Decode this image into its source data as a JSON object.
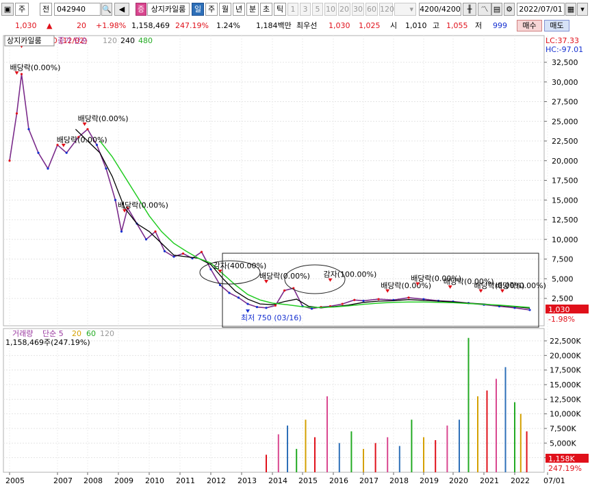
{
  "toolbar": {
    "period_type": "주",
    "prev_label": "전",
    "stock_code": "042940",
    "stock_badge": "증",
    "stock_name": "상지카일룸",
    "periods": [
      "일",
      "주",
      "월",
      "년",
      "분",
      "초",
      "틱"
    ],
    "selected_period": "일",
    "minute_options": [
      "1",
      "3",
      "5",
      "10",
      "20",
      "30",
      "60",
      "120"
    ],
    "count": "4200/4200",
    "date": "2022/07/01"
  },
  "info": {
    "price": "1,030",
    "change": "20",
    "change_pct": "+1.98%",
    "volume": "1,158,469",
    "volume_ratio": "247.19%",
    "turnover": "1.24%",
    "amount": "1,184백만",
    "best_label": "최우선",
    "best_ask": "1,030",
    "best_bid": "1,025",
    "open_label": "시",
    "open": "1,010",
    "high_label": "고",
    "high": "1,055",
    "low_label": "저",
    "low": "999",
    "buy_label": "매수",
    "sell_label": "매도"
  },
  "colors": {
    "up": "#e0101a",
    "down": "#1530d0",
    "ma120": "#000000",
    "ma240": "#22cc22",
    "price_line": "#7a2a8a"
  },
  "chart_data": [
    {
      "type": "line",
      "title": "상지카일룸",
      "legend": [
        "종가 단순",
        "120",
        "240",
        "480"
      ],
      "top_right_labels": [
        "LC:37.33",
        "HC:-97.01"
      ],
      "x_ticks": [
        "2005",
        "2007",
        "2008",
        "2009",
        "2010",
        "2011",
        "2012",
        "2013",
        "2014",
        "2015",
        "2016",
        "2017",
        "2018",
        "2019",
        "2020",
        "2021",
        "2022",
        "07/01"
      ],
      "y_ticks": [
        "32,500",
        "30,000",
        "27,500",
        "25,000",
        "22,500",
        "20,000",
        "17,500",
        "15,000",
        "12,500",
        "10,000",
        "7,500",
        "5,000",
        "2,500"
      ],
      "ylim": [
        0,
        34000
      ],
      "annotations": [
        {
          "label": "배당락(0.00%)",
          "year": 2005.3,
          "value": 31000
        },
        {
          "label": "최고 34,400 (12/02)",
          "year": 2005.5,
          "value": 34400
        },
        {
          "label": "배당락(0.00%)",
          "year": 2007.9,
          "value": 24500
        },
        {
          "label": "배당락(0.00%)",
          "year": 2007.2,
          "value": 21800
        },
        {
          "label": "배당락(0.00%)",
          "year": 2009.2,
          "value": 13500
        },
        {
          "label": "감자(400.00%)",
          "year": 2012.3,
          "value": 5800
        },
        {
          "label": "배당락(0.00%)",
          "year": 2013.8,
          "value": 4500
        },
        {
          "label": "감자(100.00%)",
          "year": 2015.9,
          "value": 4700
        },
        {
          "label": "최저 750 (03/16)",
          "year": 2013.2,
          "value": 750
        },
        {
          "label": "배당락(0.00%)",
          "year": 2017.8,
          "value": 3300
        },
        {
          "label": "배당락(0.00%)",
          "year": 2018.8,
          "value": 4200
        },
        {
          "label": "배당락(0.00%)",
          "year": 2019.9,
          "value": 3800
        },
        {
          "label": "배당락(0.00%)",
          "year": 2020.9,
          "value": 3300
        },
        {
          "label": "배당락(0.00%)",
          "year": 2021.6,
          "value": 3300
        }
      ],
      "price_badge": "1,030",
      "price_badge_pct": "-1.98%",
      "series": [
        {
          "name": "종가",
          "x": [
            2005.0,
            2005.3,
            2005.5,
            2005.8,
            2006.2,
            2006.6,
            2007.0,
            2007.3,
            2007.7,
            2008.0,
            2008.3,
            2008.6,
            2008.9,
            2009.1,
            2009.3,
            2009.6,
            2009.9,
            2010.2,
            2010.5,
            2010.8,
            2011.1,
            2011.4,
            2011.7,
            2012.0,
            2012.3,
            2012.6,
            2012.9,
            2013.2,
            2013.5,
            2013.8,
            2014.1,
            2014.4,
            2014.7,
            2015.0,
            2015.3,
            2015.6,
            2015.9,
            2016.3,
            2016.7,
            2017.0,
            2017.5,
            2018.0,
            2018.5,
            2019.0,
            2019.5,
            2020.0,
            2020.5,
            2021.0,
            2021.5,
            2022.0,
            2022.5
          ],
          "y": [
            20000,
            26000,
            31000,
            24000,
            21000,
            19000,
            22000,
            21000,
            23000,
            24000,
            22000,
            19000,
            15000,
            11000,
            14000,
            12000,
            10000,
            11000,
            8500,
            7800,
            8200,
            7600,
            8400,
            6200,
            4200,
            3200,
            2600,
            1800,
            1400,
            1300,
            1600,
            3500,
            3800,
            1500,
            1200,
            1400,
            1500,
            1800,
            2300,
            2200,
            2400,
            2300,
            2600,
            2400,
            2200,
            2100,
            1900,
            1700,
            1500,
            1300,
            1030
          ]
        },
        {
          "name": "120",
          "x": [
            2007.6,
            2008.0,
            2008.4,
            2008.8,
            2009.2,
            2009.6,
            2010.0,
            2010.4,
            2010.8,
            2011.2,
            2011.6,
            2012.0,
            2012.4,
            2012.8,
            2013.2,
            2013.6,
            2014.0,
            2014.4,
            2014.8,
            2015.2,
            2015.6,
            2016.0,
            2016.5,
            2017.0,
            2017.5,
            2018.0,
            2018.5,
            2019.0,
            2019.5,
            2020.0,
            2020.5,
            2021.0,
            2021.5,
            2022.0,
            2022.5
          ],
          "y": [
            24000,
            22500,
            21000,
            18000,
            14000,
            12000,
            11000,
            9500,
            8000,
            7800,
            7600,
            6800,
            5000,
            3400,
            2400,
            1800,
            1700,
            2100,
            2400,
            1500,
            1300,
            1450,
            1650,
            2000,
            2150,
            2200,
            2350,
            2250,
            2150,
            2050,
            1900,
            1800,
            1600,
            1450,
            1250
          ]
        },
        {
          "name": "240",
          "x": [
            2008.4,
            2008.8,
            2009.2,
            2009.6,
            2010.0,
            2010.4,
            2010.8,
            2011.2,
            2011.6,
            2012.0,
            2012.4,
            2012.8,
            2013.2,
            2013.6,
            2014.0,
            2014.5,
            2015.0,
            2015.5,
            2016.0,
            2016.5,
            2017.0,
            2017.5,
            2018.0,
            2018.5,
            2019.0,
            2019.5,
            2020.0,
            2020.5,
            2021.0,
            2021.5,
            2022.0,
            2022.5
          ],
          "y": [
            22500,
            20500,
            18000,
            15500,
            13000,
            11000,
            9500,
            8500,
            7600,
            7000,
            5600,
            4200,
            3000,
            2300,
            1900,
            1700,
            1450,
            1350,
            1400,
            1550,
            1750,
            1900,
            2000,
            2050,
            2050,
            2000,
            1950,
            1850,
            1750,
            1650,
            1500,
            1350
          ]
        }
      ]
    },
    {
      "type": "bar",
      "title": "거래량",
      "legend": [
        "거래량",
        "단순 5",
        "20",
        "60",
        "120"
      ],
      "subtitle": "1,158,469주(247.19%)",
      "y_ticks": [
        "22,500K",
        "20,000K",
        "17,500K",
        "15,000K",
        "12,500K",
        "10,000K",
        "7,500K",
        "5,000K",
        "2,500K"
      ],
      "ylim": [
        0,
        24000
      ],
      "volume_badge": "1,158K",
      "volume_badge_pct": "247.19%",
      "x": [
        2013.8,
        2014.2,
        2014.5,
        2014.8,
        2015.1,
        2015.4,
        2015.8,
        2016.2,
        2016.6,
        2017.0,
        2017.4,
        2017.8,
        2018.2,
        2018.6,
        2019.0,
        2019.4,
        2019.8,
        2020.2,
        2020.5,
        2020.8,
        2021.1,
        2021.4,
        2021.7,
        2022.0,
        2022.2,
        2022.4
      ],
      "values": [
        3000,
        6500,
        8000,
        4000,
        9000,
        6000,
        13000,
        5000,
        7000,
        4000,
        5000,
        6000,
        4500,
        9000,
        6000,
        5500,
        8000,
        9000,
        23000,
        13000,
        14000,
        16000,
        18000,
        12000,
        10000,
        7000
      ]
    }
  ]
}
